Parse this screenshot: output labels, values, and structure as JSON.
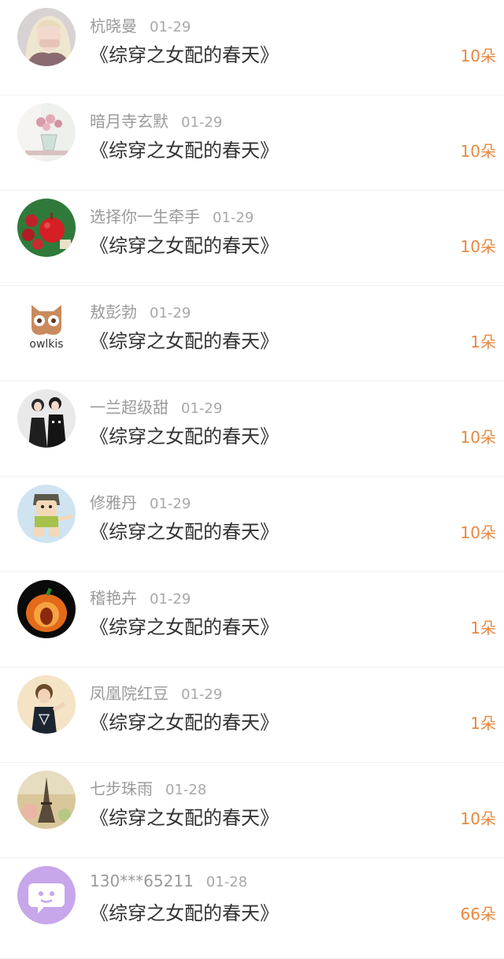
{
  "colors": {
    "accent": "#e8883f",
    "name_gray": "#9a9a9a",
    "title_dark": "#333333"
  },
  "items": [
    {
      "avatar": "woman-photo-avatar",
      "name": "杭晓曼",
      "date": "01-29",
      "title": "《综穿之女配的春天》",
      "count": "10朵"
    },
    {
      "avatar": "roses-vase-avatar",
      "name": "暗月寺玄默",
      "date": "01-29",
      "title": "《综穿之女配的春天》",
      "count": "10朵"
    },
    {
      "avatar": "red-apple-roses-avatar",
      "name": "选择你一生牵手",
      "date": "01-29",
      "title": "《综穿之女配的春天》",
      "count": "10朵"
    },
    {
      "avatar": "owl-logo-avatar",
      "avatar_text": "owlkis",
      "name": "敖彭勃",
      "date": "01-29",
      "title": "《综穿之女配的春天》",
      "count": "1朵"
    },
    {
      "avatar": "couple-photo-avatar",
      "name": "一兰超级甜",
      "date": "01-29",
      "title": "《综穿之女配的春天》",
      "count": "10朵"
    },
    {
      "avatar": "cartoon-character-avatar",
      "name": "修雅丹",
      "date": "01-29",
      "title": "《综穿之女配的春天》",
      "count": "10朵"
    },
    {
      "avatar": "pumpkin-avatar",
      "name": "稽艳卉",
      "date": "01-29",
      "title": "《综穿之女配的春天》",
      "count": "1朵"
    },
    {
      "avatar": "boy-photo-avatar",
      "name": "凤凰院红豆",
      "date": "01-29",
      "title": "《综穿之女配的春天》",
      "count": "1朵"
    },
    {
      "avatar": "eiffel-tower-avatar",
      "name": "七步珠雨",
      "date": "01-28",
      "title": "《综穿之女配的春天》",
      "count": "10朵"
    },
    {
      "avatar": "default-chat-avatar",
      "name": "130***65211",
      "date": "01-28",
      "title": "《综穿之女配的春天》",
      "count": "66朵"
    }
  ]
}
